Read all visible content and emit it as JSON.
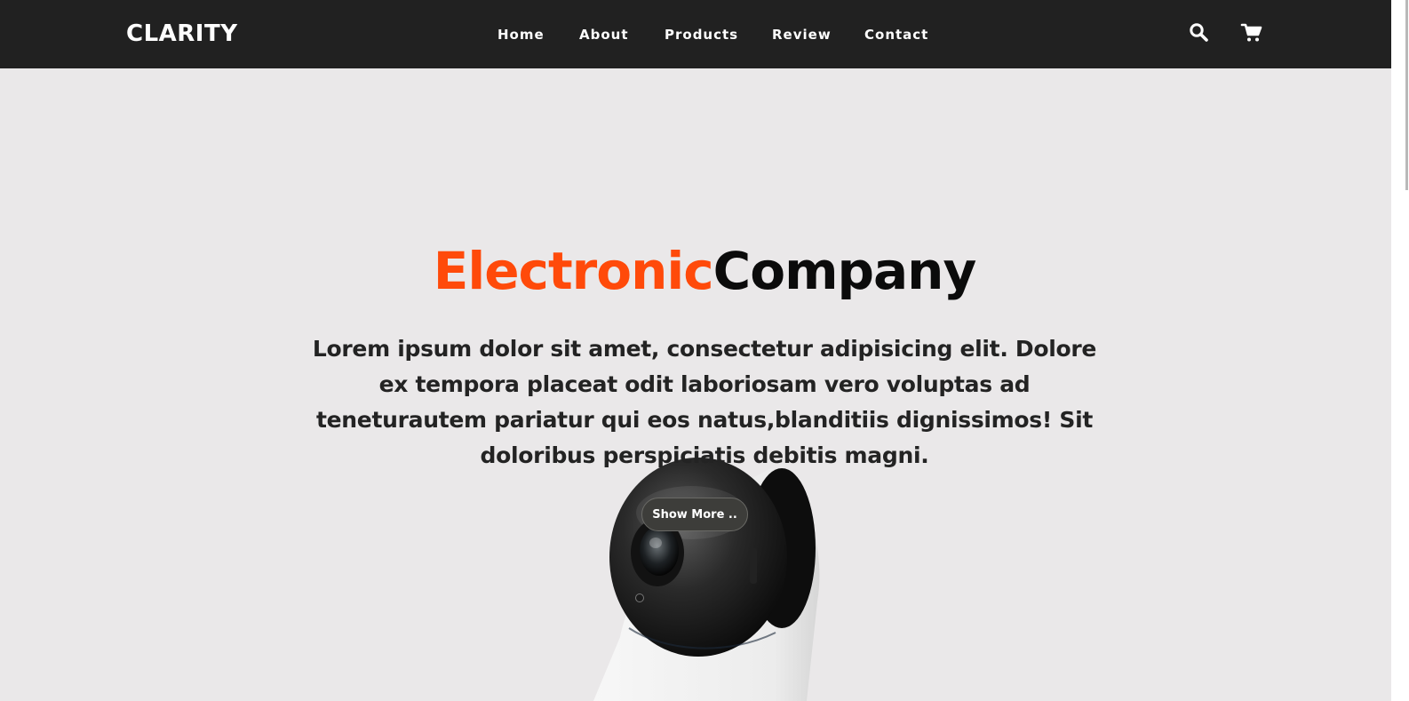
{
  "navbar": {
    "logo": "CLARITY",
    "links": [
      "Home",
      "About",
      "Products",
      "Review",
      "Contact"
    ],
    "icons": [
      "search-icon",
      "cart-icon"
    ]
  },
  "hero": {
    "title_accent": "Electronic",
    "title_rest": "Company",
    "text": "Lorem ipsum dolor sit amet, consectetur adipisicing elit. Dolore ex tempora placeat odit laboriosam vero voluptas ad teneturautem pariatur qui eos natus,blanditiis dignissimos! Sit doloribus perspiciatis debitis magni.",
    "button_label": "Show More .."
  },
  "colors": {
    "navbar_bg": "#212121",
    "page_bg": "#eae8e9",
    "accent": "#ff4a0a",
    "button_bg": "#3d3d3a"
  }
}
